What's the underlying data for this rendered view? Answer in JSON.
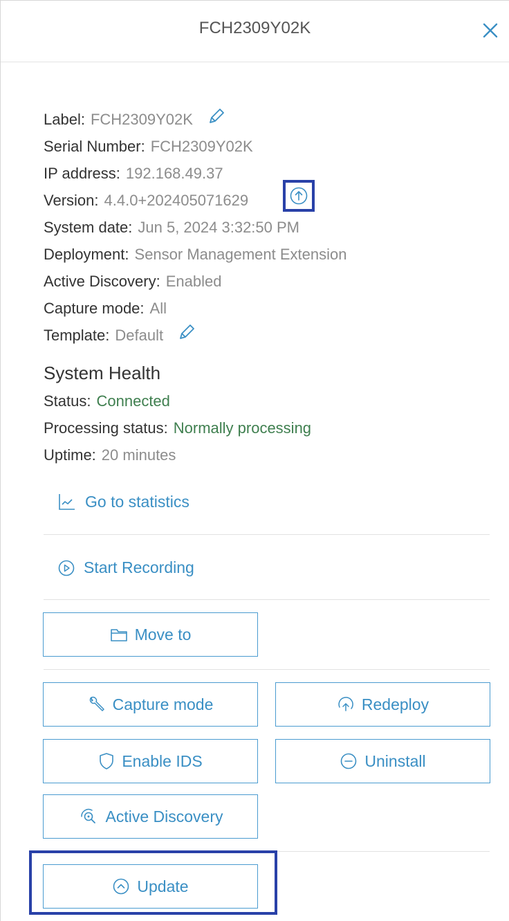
{
  "header": {
    "title": "FCH2309Y02K"
  },
  "details": {
    "label": {
      "key": "Label:",
      "value": "FCH2309Y02K"
    },
    "serial": {
      "key": "Serial Number:",
      "value": "FCH2309Y02K"
    },
    "ip": {
      "key": "IP address:",
      "value": "192.168.49.37"
    },
    "version": {
      "key": "Version:",
      "value": "4.4.0+202405071629"
    },
    "system_date": {
      "key": "System date:",
      "value": "Jun 5, 2024 3:32:50 PM"
    },
    "deployment": {
      "key": "Deployment:",
      "value": "Sensor Management Extension"
    },
    "active_discovery": {
      "key": "Active Discovery:",
      "value": "Enabled"
    },
    "capture_mode": {
      "key": "Capture mode:",
      "value": "All"
    },
    "template": {
      "key": "Template:",
      "value": "Default"
    }
  },
  "health": {
    "title": "System Health",
    "status": {
      "key": "Status:",
      "value": "Connected"
    },
    "processing": {
      "key": "Processing status:",
      "value": "Normally processing"
    },
    "uptime": {
      "key": "Uptime:",
      "value": "20 minutes"
    }
  },
  "links": {
    "statistics": "Go to statistics",
    "recording": "Start Recording"
  },
  "buttons": {
    "move_to": "Move to",
    "capture_mode": "Capture mode",
    "redeploy": "Redeploy",
    "enable_ids": "Enable IDS",
    "uninstall": "Uninstall",
    "active_discovery": "Active Discovery",
    "update": "Update"
  },
  "icons": {
    "close": "close-icon",
    "edit": "pencil-icon",
    "upgrade": "arrow-up-circle-icon",
    "statistics": "line-chart-icon",
    "record": "play-circle-icon",
    "folder": "folder-icon",
    "wrench": "wrench-icon",
    "redeploy": "redeploy-icon",
    "shield": "shield-icon",
    "minus": "minus-circle-icon",
    "discovery": "radar-search-icon",
    "update": "chevron-up-circle-icon"
  },
  "colors": {
    "accent": "#3a8fc4",
    "ok_green": "#3f7f4f",
    "highlight": "#2941a8",
    "muted": "#8c8c8c"
  }
}
